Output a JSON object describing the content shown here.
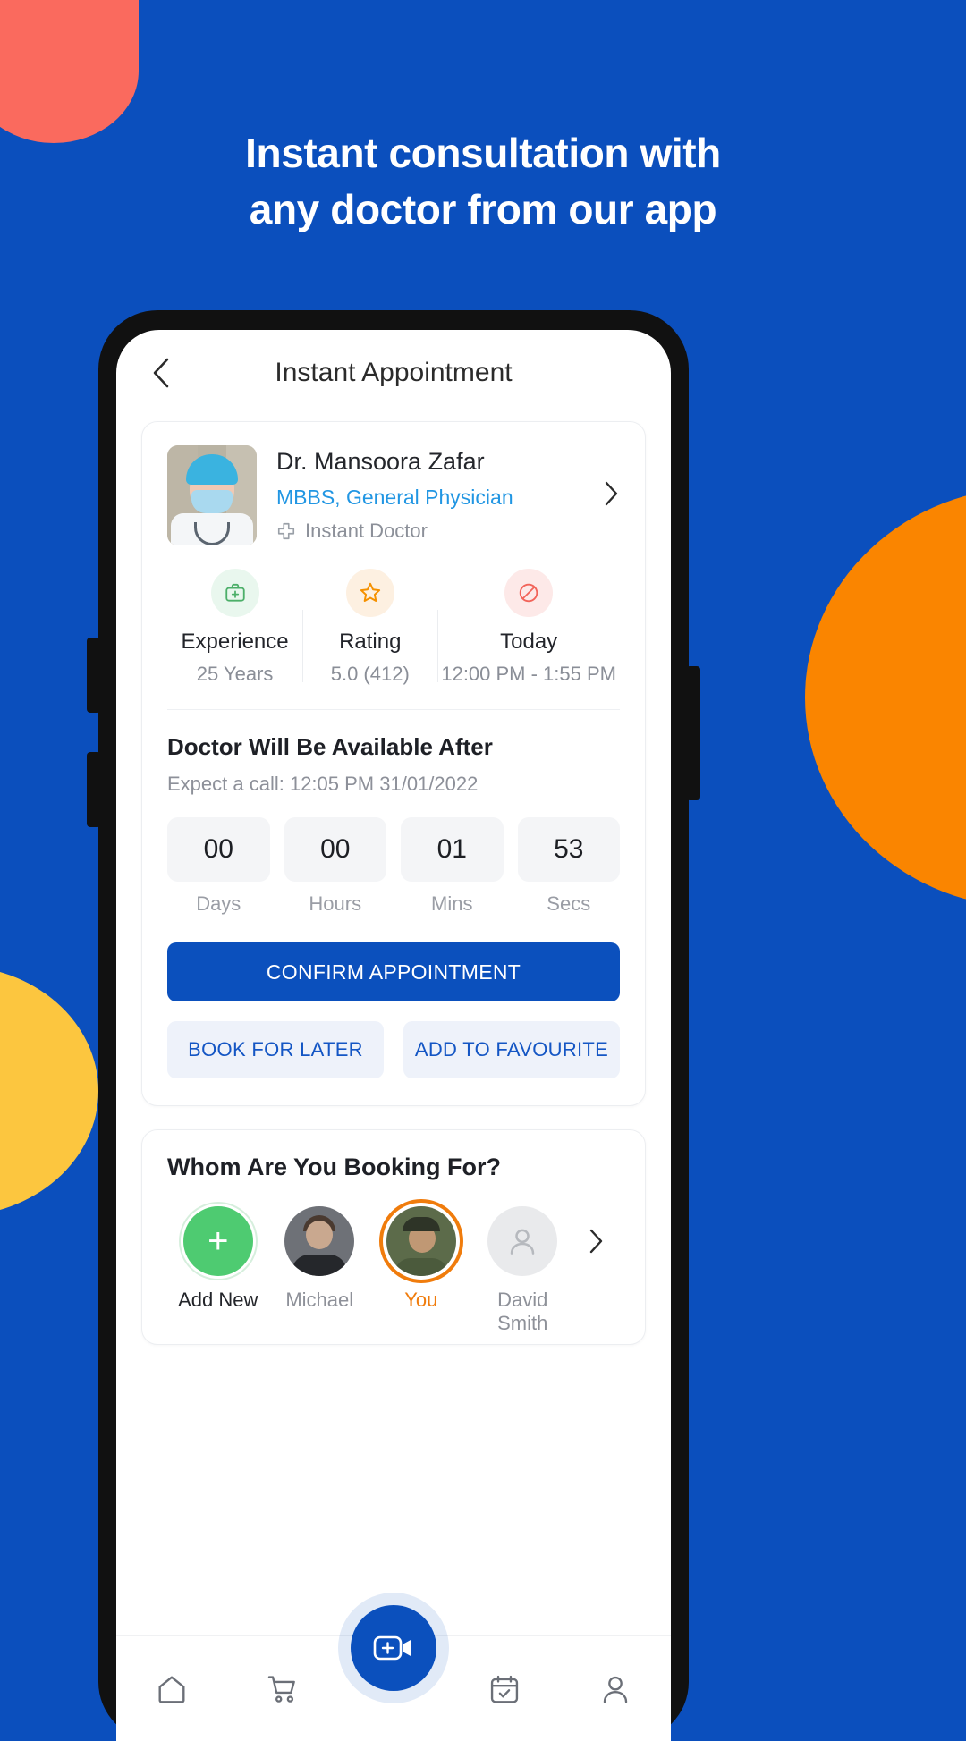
{
  "hero": {
    "headline_line1": "Instant consultation with",
    "headline_line2": "any doctor from our app",
    "bg_color": "#0b4fbd",
    "blob_red": "#fa6a5e",
    "blob_orange": "#fa8500",
    "blob_yellow": "#fcc63f"
  },
  "app": {
    "title": "Instant Appointment",
    "back_icon": "chevron-left-icon"
  },
  "doctor": {
    "name": "Dr. Mansoora Zafar",
    "specialty": "MBBS, General Physician",
    "tag": "Instant Doctor",
    "tag_icon": "medical-cross-icon",
    "chevron_icon": "chevron-right-icon",
    "specialty_color": "#2196e3"
  },
  "stats": [
    {
      "label": "Experience",
      "value": "25 Years",
      "icon": "medical-bag-icon",
      "icon_color": "#4caf69",
      "bg": "#e9f7ee"
    },
    {
      "label": "Rating",
      "value": "5.0 (412)",
      "icon": "star-icon",
      "icon_color": "#f59100",
      "bg": "#fdf0e1"
    },
    {
      "label": "Today",
      "value": "12:00 PM - 1:55 PM",
      "icon": "no-entry-icon",
      "icon_color": "#f2645a",
      "bg": "#fde9e8"
    }
  ],
  "availability": {
    "title": "Doctor Will Be Available After",
    "subtitle": "Expect a call: 12:05 PM 31/01/2022"
  },
  "countdown": [
    {
      "value": "00",
      "label": "Days"
    },
    {
      "value": "00",
      "label": "Hours"
    },
    {
      "value": "01",
      "label": "Mins"
    },
    {
      "value": "53",
      "label": "Secs"
    }
  ],
  "actions": {
    "confirm": "CONFIRM APPOINTMENT",
    "book_later": "BOOK FOR LATER",
    "add_favourite": "ADD TO FAVOURITE",
    "primary_color": "#0b50bd",
    "secondary_color": "#1456c4"
  },
  "booking": {
    "title": "Whom Are You Booking For?",
    "next_icon": "chevron-right-icon",
    "people": [
      {
        "name": "Add New",
        "type": "add",
        "selected": false
      },
      {
        "name": "Michael",
        "type": "photo",
        "selected": false
      },
      {
        "name": "You",
        "type": "photo",
        "selected": true
      },
      {
        "name": "David Smith",
        "type": "placeholder",
        "selected": false
      }
    ]
  },
  "nav": {
    "items": [
      {
        "icon": "home-icon",
        "label": "Home"
      },
      {
        "icon": "cart-icon",
        "label": "Cart"
      },
      {
        "icon": "calendar-check-icon",
        "label": "Appointments"
      },
      {
        "icon": "person-icon",
        "label": "Profile"
      }
    ],
    "fab_icon": "video-call-add-icon",
    "fab_color": "#0b50bd"
  }
}
